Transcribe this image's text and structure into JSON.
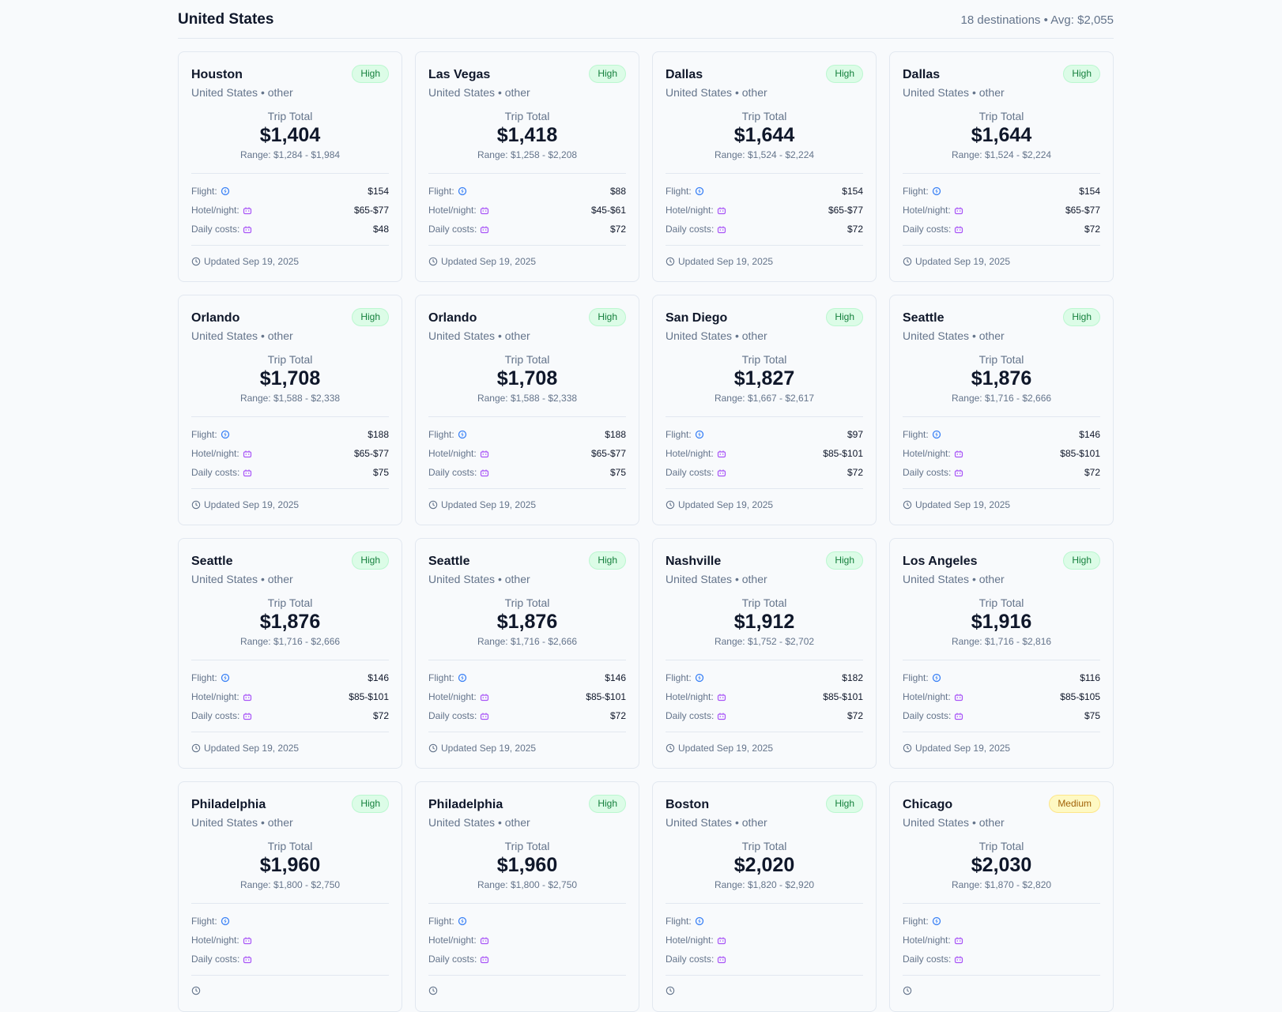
{
  "section": {
    "title": "United States",
    "stats": "18 destinations • Avg: $2,055"
  },
  "labels": {
    "trip_total": "Trip Total",
    "flight": "Flight:",
    "hotel": "Hotel/night:",
    "daily": "Daily costs:",
    "range_prefix": "Range: "
  },
  "colors": {
    "flight_icon": "#3b82f6",
    "hotel_icon": "#a855f7",
    "badge_high_bg": "#dcfce7",
    "badge_medium_bg": "#fef9c3"
  },
  "cards": [
    {
      "city": "Houston",
      "sub": "United States • other",
      "badge": "High",
      "total": "$1,404",
      "range": "Range: $1,284 - $1,984",
      "flight": "$154",
      "hotel": "$65-$77",
      "daily": "$48",
      "updated": "Updated Sep 19, 2025"
    },
    {
      "city": "Las Vegas",
      "sub": "United States • other",
      "badge": "High",
      "total": "$1,418",
      "range": "Range: $1,258 - $2,208",
      "flight": "$88",
      "hotel": "$45-$61",
      "daily": "$72",
      "updated": "Updated Sep 19, 2025"
    },
    {
      "city": "Dallas",
      "sub": "United States • other",
      "badge": "High",
      "total": "$1,644",
      "range": "Range: $1,524 - $2,224",
      "flight": "$154",
      "hotel": "$65-$77",
      "daily": "$72",
      "updated": "Updated Sep 19, 2025"
    },
    {
      "city": "Dallas",
      "sub": "United States • other",
      "badge": "High",
      "total": "$1,644",
      "range": "Range: $1,524 - $2,224",
      "flight": "$154",
      "hotel": "$65-$77",
      "daily": "$72",
      "updated": "Updated Sep 19, 2025"
    },
    {
      "city": "Orlando",
      "sub": "United States • other",
      "badge": "High",
      "total": "$1,708",
      "range": "Range: $1,588 - $2,338",
      "flight": "$188",
      "hotel": "$65-$77",
      "daily": "$75",
      "updated": "Updated Sep 19, 2025"
    },
    {
      "city": "Orlando",
      "sub": "United States • other",
      "badge": "High",
      "total": "$1,708",
      "range": "Range: $1,588 - $2,338",
      "flight": "$188",
      "hotel": "$65-$77",
      "daily": "$75",
      "updated": "Updated Sep 19, 2025"
    },
    {
      "city": "San Diego",
      "sub": "United States • other",
      "badge": "High",
      "total": "$1,827",
      "range": "Range: $1,667 - $2,617",
      "flight": "$97",
      "hotel": "$85-$101",
      "daily": "$72",
      "updated": "Updated Sep 19, 2025"
    },
    {
      "city": "Seattle",
      "sub": "United States • other",
      "badge": "High",
      "total": "$1,876",
      "range": "Range: $1,716 - $2,666",
      "flight": "$146",
      "hotel": "$85-$101",
      "daily": "$72",
      "updated": "Updated Sep 19, 2025"
    },
    {
      "city": "Seattle",
      "sub": "United States • other",
      "badge": "High",
      "total": "$1,876",
      "range": "Range: $1,716 - $2,666",
      "flight": "$146",
      "hotel": "$85-$101",
      "daily": "$72",
      "updated": "Updated Sep 19, 2025"
    },
    {
      "city": "Seattle",
      "sub": "United States • other",
      "badge": "High",
      "total": "$1,876",
      "range": "Range: $1,716 - $2,666",
      "flight": "$146",
      "hotel": "$85-$101",
      "daily": "$72",
      "updated": "Updated Sep 19, 2025"
    },
    {
      "city": "Nashville",
      "sub": "United States • other",
      "badge": "High",
      "total": "$1,912",
      "range": "Range: $1,752 - $2,702",
      "flight": "$182",
      "hotel": "$85-$101",
      "daily": "$72",
      "updated": "Updated Sep 19, 2025"
    },
    {
      "city": "Los Angeles",
      "sub": "United States • other",
      "badge": "High",
      "total": "$1,916",
      "range": "Range: $1,716 - $2,816",
      "flight": "$116",
      "hotel": "$85-$105",
      "daily": "$75",
      "updated": "Updated Sep 19, 2025"
    },
    {
      "city": "Philadelphia",
      "sub": "United States • other",
      "badge": "High",
      "total": "$1,960",
      "range": "Range: $1,800 - $2,750",
      "flight": "",
      "hotel": "",
      "daily": "",
      "updated": ""
    },
    {
      "city": "Philadelphia",
      "sub": "United States • other",
      "badge": "High",
      "total": "$1,960",
      "range": "Range: $1,800 - $2,750",
      "flight": "",
      "hotel": "",
      "daily": "",
      "updated": ""
    },
    {
      "city": "Boston",
      "sub": "United States • other",
      "badge": "High",
      "total": "$2,020",
      "range": "Range: $1,820 - $2,920",
      "flight": "",
      "hotel": "",
      "daily": "",
      "updated": ""
    },
    {
      "city": "Chicago",
      "sub": "United States • other",
      "badge": "Medium",
      "total": "$2,030",
      "range": "Range: $1,870 - $2,820",
      "flight": "",
      "hotel": "",
      "daily": "",
      "updated": ""
    }
  ]
}
